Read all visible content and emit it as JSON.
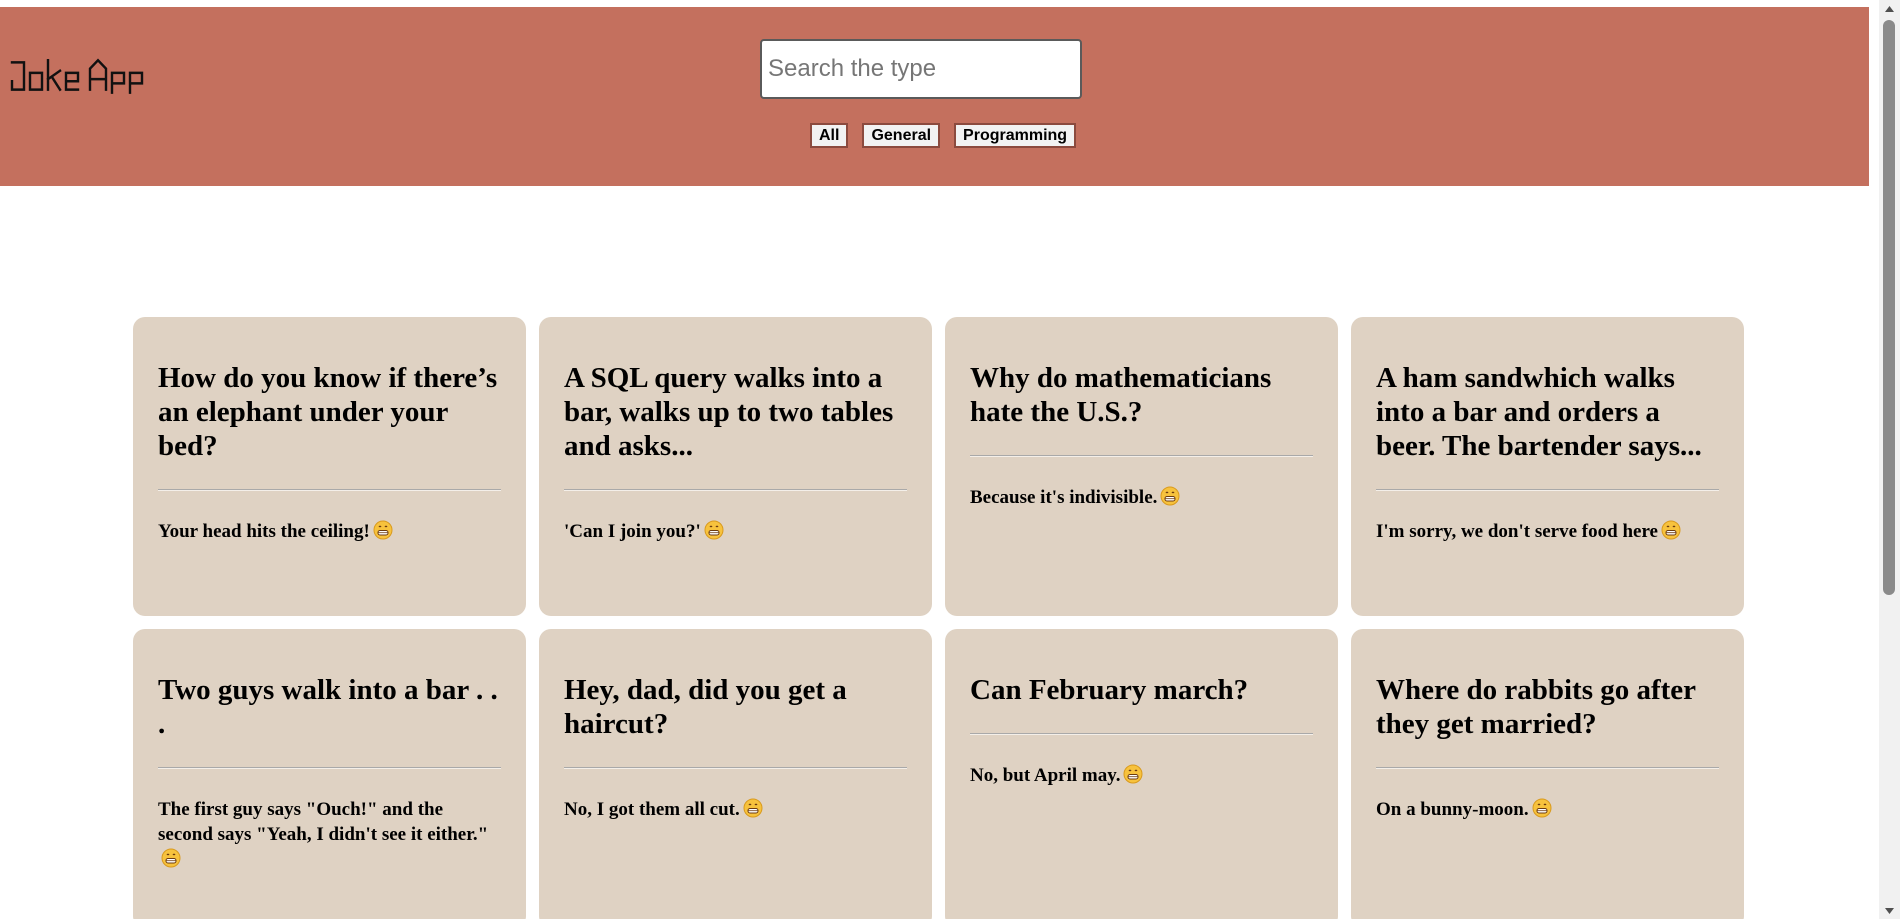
{
  "header": {
    "logo_text": "Joke App",
    "search": {
      "placeholder": "Search the type",
      "value": ""
    },
    "filters": [
      {
        "label": "All"
      },
      {
        "label": "General"
      },
      {
        "label": "Programming"
      }
    ]
  },
  "jokes": [
    {
      "setup": "How do you know if there’s an elephant under your bed?",
      "punchline": "Your head hits the ceiling!"
    },
    {
      "setup": "A SQL query walks into a bar, walks up to two tables and asks...",
      "punchline": "'Can I join you?'"
    },
    {
      "setup": "Why do mathematicians hate the U.S.?",
      "punchline": "Because it's indivisible."
    },
    {
      "setup": "A ham sandwhich walks into a bar and orders a beer. The bartender says...",
      "punchline": "I'm sorry, we don't serve food here"
    },
    {
      "setup": "Two guys walk into a bar . . .",
      "punchline": "The first guy says \"Ouch!\" and the second says \"Yeah, I didn't see it either.\""
    },
    {
      "setup": "Hey, dad, did you get a haircut?",
      "punchline": "No, I got them all cut."
    },
    {
      "setup": "Can February march?",
      "punchline": "No, but April may."
    },
    {
      "setup": "Where do rabbits go after they get married?",
      "punchline": "On a bunny-moon."
    }
  ],
  "icons": {
    "emoji": "grinning-face-icon",
    "emoji_color": "#f7c23d"
  },
  "colors": {
    "header_bg": "#c4705e",
    "card_bg": "#dfd2c3"
  }
}
